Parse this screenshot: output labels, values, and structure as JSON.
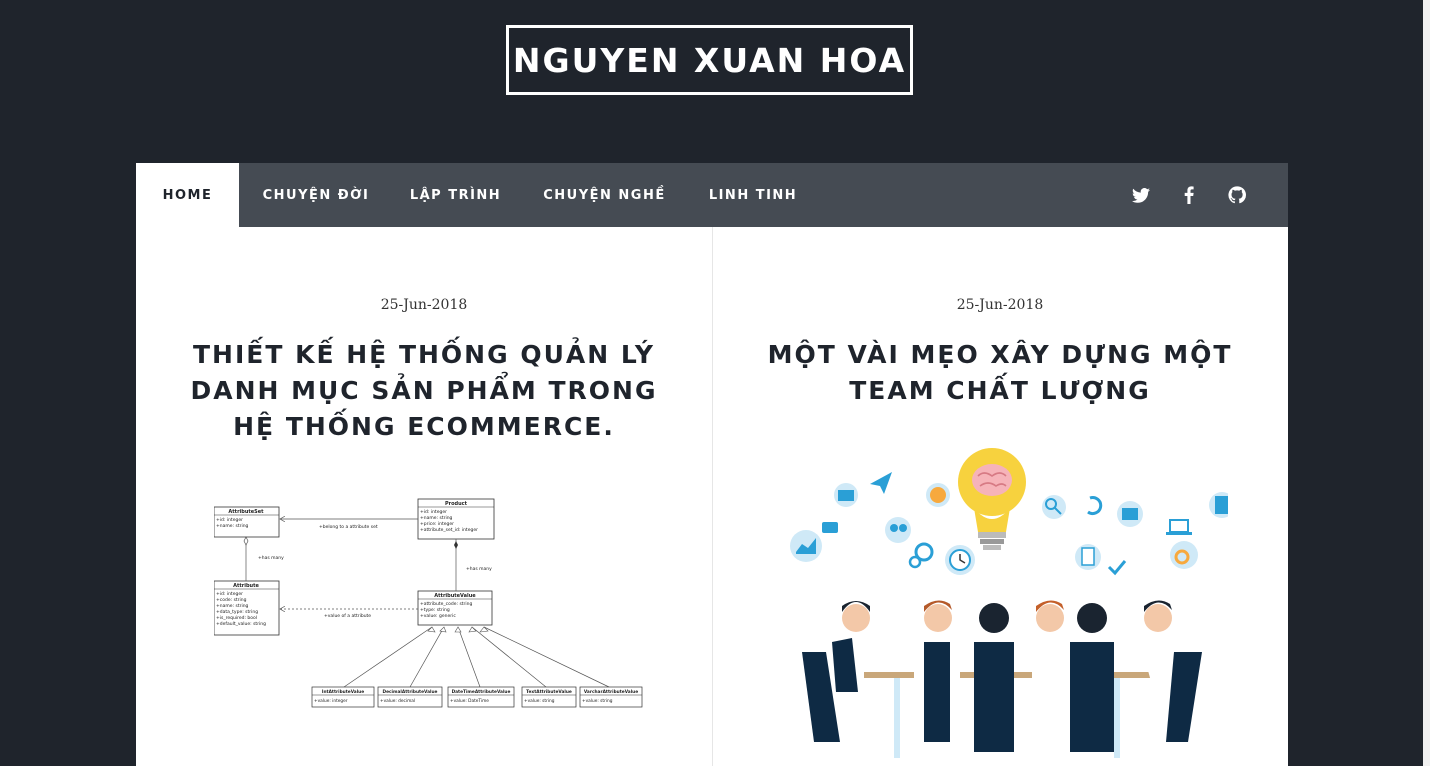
{
  "site": {
    "title": "NGUYEN XUAN HOA"
  },
  "nav": {
    "items": [
      {
        "label": "HOME",
        "active": true
      },
      {
        "label": "CHUYỆN ĐỜI"
      },
      {
        "label": "LẬP TRÌNH"
      },
      {
        "label": "CHUYỆN NGHỀ"
      },
      {
        "label": "LINH TINH"
      }
    ],
    "social": [
      "twitter-icon",
      "facebook-icon",
      "github-icon"
    ]
  },
  "posts": [
    {
      "date": "25-Jun-2018",
      "title": "THIẾT KẾ HỆ THỐNG QUẢN LÝ DANH MỤC SẢN PHẨM TRONG HỆ THỐNG ECOMMERCE.",
      "diagram": {
        "attribute_set": {
          "name": "AttributeSet",
          "fields": [
            "+id: integer",
            "+name: string"
          ]
        },
        "product": {
          "name": "Product",
          "fields": [
            "+id: integer",
            "+name: string",
            "+price: integer",
            "+attribute_set_id: integer"
          ]
        },
        "attribute": {
          "name": "Attribute",
          "fields": [
            "+id: integer",
            "+code: string",
            "+name: string",
            "+data_type: string",
            "+is_required: bool",
            "+default_value: string"
          ]
        },
        "attribute_value": {
          "name": "AttributeValue",
          "fields": [
            "+attribute_code: string",
            "+type: string",
            "+value: generic"
          ]
        },
        "subclasses": [
          {
            "name": "IntAttributeValue",
            "field": "+value: integer"
          },
          {
            "name": "DecimalAttributeValue",
            "field": "+value: decimal"
          },
          {
            "name": "DateTimeAttributeValue",
            "field": "+value: DateTime"
          },
          {
            "name": "TextAttributeValue",
            "field": "+value: string"
          },
          {
            "name": "VarcharAttributeValue",
            "field": "+value: string"
          }
        ],
        "labels": {
          "belong": "+belong to a attribute set",
          "has_many_left": "+has many",
          "has_many_right": "+has many",
          "value_of": "+value of a attribute"
        }
      }
    },
    {
      "date": "25-Jun-2018",
      "title": "MỘT VÀI MẸO XÂY DỰNG MỘT TEAM CHẤT LƯỢNG"
    }
  ],
  "colors": {
    "page_bg": "#1f242c",
    "nav_bg": "#454b53",
    "accent_blue": "#2a9fd6",
    "bulb_yellow": "#f7d23e"
  }
}
